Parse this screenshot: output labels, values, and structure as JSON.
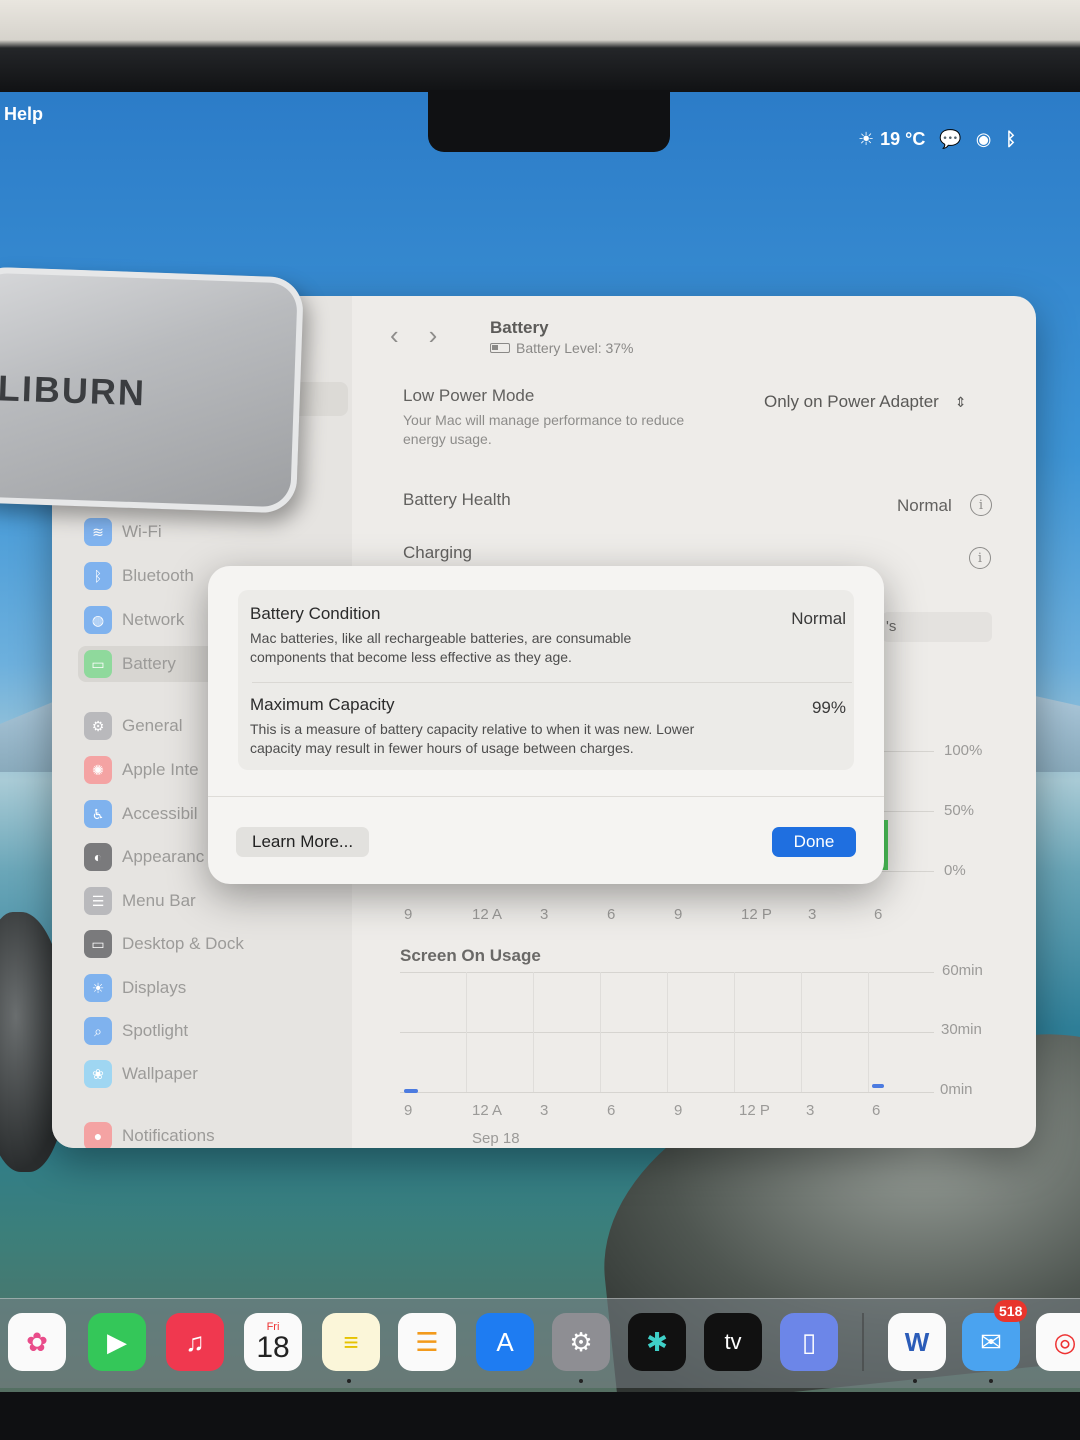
{
  "menubar": {
    "menu_help": "Help",
    "weather": "19 °C"
  },
  "window": {
    "title": "Battery",
    "battery_level": "Battery Level: 37%"
  },
  "sidebar": {
    "items": [
      {
        "label": "Wi-Fi",
        "icon": "wifi-icon",
        "color": "#3b8ef0"
      },
      {
        "label": "Bluetooth",
        "icon": "bluetooth-icon",
        "color": "#3b8ef0"
      },
      {
        "label": "Network",
        "icon": "globe-icon",
        "color": "#3b8ef0"
      },
      {
        "label": "Battery",
        "icon": "battery-icon",
        "color": "#35c759"
      },
      {
        "label": "General",
        "icon": "gear-icon",
        "color": "#8e8e93"
      },
      {
        "label": "Apple Inte",
        "icon": "apple-intelligence-icon",
        "color": "#f06a6a"
      },
      {
        "label": "Accessibil",
        "icon": "accessibility-icon",
        "color": "#3b8ef0"
      },
      {
        "label": "Appearanc",
        "icon": "appearance-icon",
        "color": "#1c1c1e"
      },
      {
        "label": "Menu Bar",
        "icon": "menu-bar-icon",
        "color": "#8e8e93"
      },
      {
        "label": "Desktop & Dock",
        "icon": "dock-icon",
        "color": "#1c1c1e"
      },
      {
        "label": "Displays",
        "icon": "displays-icon",
        "color": "#3b8ef0"
      },
      {
        "label": "Spotlight",
        "icon": "spotlight-icon",
        "color": "#3b8ef0"
      },
      {
        "label": "Wallpaper",
        "icon": "wallpaper-icon",
        "color": "#5ac8fa"
      },
      {
        "label": "Notifications",
        "icon": "notifications-icon",
        "color": "#f05a5a"
      }
    ]
  },
  "settings": {
    "low_power_mode": {
      "title": "Low Power Mode",
      "description_line1": "Your Mac will manage performance to reduce",
      "description_line2": "energy usage.",
      "value": "Only on Power Adapter"
    },
    "battery_health": {
      "title": "Battery Health",
      "value": "Normal"
    },
    "charging": {
      "title": "Charging"
    },
    "partial_label": "'s"
  },
  "level_chart": {
    "y_labels": [
      "100%",
      "50%",
      "0%"
    ],
    "x_labels": [
      "9",
      "12 A",
      "3",
      "6",
      "9",
      "12 P",
      "3",
      "6"
    ]
  },
  "usage_chart": {
    "title": "Screen On Usage",
    "y_labels": [
      "60min",
      "30min",
      "0min"
    ],
    "x_labels": [
      "9",
      "12 A",
      "3",
      "6",
      "9",
      "12 P",
      "3",
      "6"
    ],
    "date_label": "Sep 18"
  },
  "dialog": {
    "battery_condition": {
      "title": "Battery Condition",
      "value": "Normal",
      "description_line1": "Mac batteries, like all rechargeable batteries, are consumable",
      "description_line2": "components that become less effective as they age."
    },
    "maximum_capacity": {
      "title": "Maximum Capacity",
      "value": "99%",
      "description_line1": "This is a measure of battery capacity relative to when it was new. Lower",
      "description_line2": "capacity may result in fewer hours of usage between charges."
    },
    "learn_more_label": "Learn More...",
    "done_label": "Done"
  },
  "foreground_object": {
    "label": "ALIBURN"
  },
  "dock": {
    "calendar_month": "Fri",
    "calendar_day": "18",
    "tv_label": "tv",
    "mail_badge": "518",
    "word_label": "W"
  },
  "colors": {
    "accent": "#1f6fe0",
    "active_battery": "#35c759"
  }
}
